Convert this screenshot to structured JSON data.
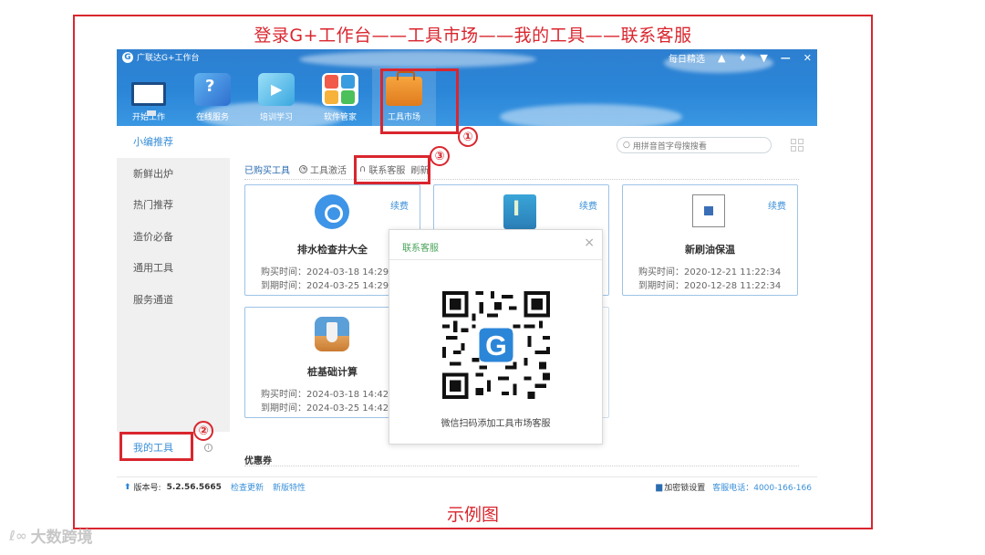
{
  "heading": "登录G+工作台——工具市场——我的工具——联系客服",
  "caption": "示例图",
  "watermark": "大数跨境",
  "app": {
    "window_title": "广联达G+工作台",
    "daily_pick": "每日精选",
    "nav": [
      {
        "label": "开始工作",
        "icon": "monitor-icon"
      },
      {
        "label": "在线服务",
        "icon": "service-icon"
      },
      {
        "label": "培训学习",
        "icon": "video-icon"
      },
      {
        "label": "软件管家",
        "icon": "apps-icon"
      },
      {
        "label": "工具市场",
        "icon": "toolbox-icon"
      }
    ],
    "sidebar": [
      "小编推荐",
      "新鲜出炉",
      "热门推荐",
      "造价必备",
      "通用工具",
      "服务通道"
    ],
    "my_tools": "我的工具",
    "search_placeholder": "用拼音首字母搜搜看",
    "tabs": {
      "purchased": "已购买工具",
      "activate": "工具激活",
      "support": "联系客服",
      "refresh": "刷新"
    },
    "cards": [
      {
        "name": "排水检查井大全",
        "renew": "续费",
        "buy": "购买时间：2024-03-18 14:29",
        "expire": "到期时间：2024-03-25 14:29"
      },
      {
        "name": "",
        "renew": "续费",
        "buy": "",
        "expire": ""
      },
      {
        "name": "新刷油保温",
        "renew": "续费",
        "buy": "购买时间：2020-12-21 11:22:34",
        "expire": "到期时间：2020-12-28 11:22:34"
      },
      {
        "name": "桩基础计算",
        "renew": "",
        "buy": "购买时间：2024-03-18 14:42",
        "expire": "到期时间：2024-03-25 14:42"
      }
    ],
    "coupon": "优惠券",
    "status": {
      "version_label": "版本号:",
      "version": "5.2.56.5665",
      "check_update": "检查更新",
      "new_features": "新版特性",
      "lock_settings": "加密锁设置",
      "phone": "客服电话：4000-166-166"
    },
    "popup": {
      "title": "联系客服",
      "close": "×",
      "tip": "微信扫码添加工具市场客服"
    }
  },
  "annotations": [
    "①",
    "②",
    "③"
  ],
  "colors": {
    "accent_red": "#d9262e",
    "brand_blue": "#2b86d8",
    "link_blue": "#3a8fd8",
    "popup_green": "#4aa35a"
  }
}
